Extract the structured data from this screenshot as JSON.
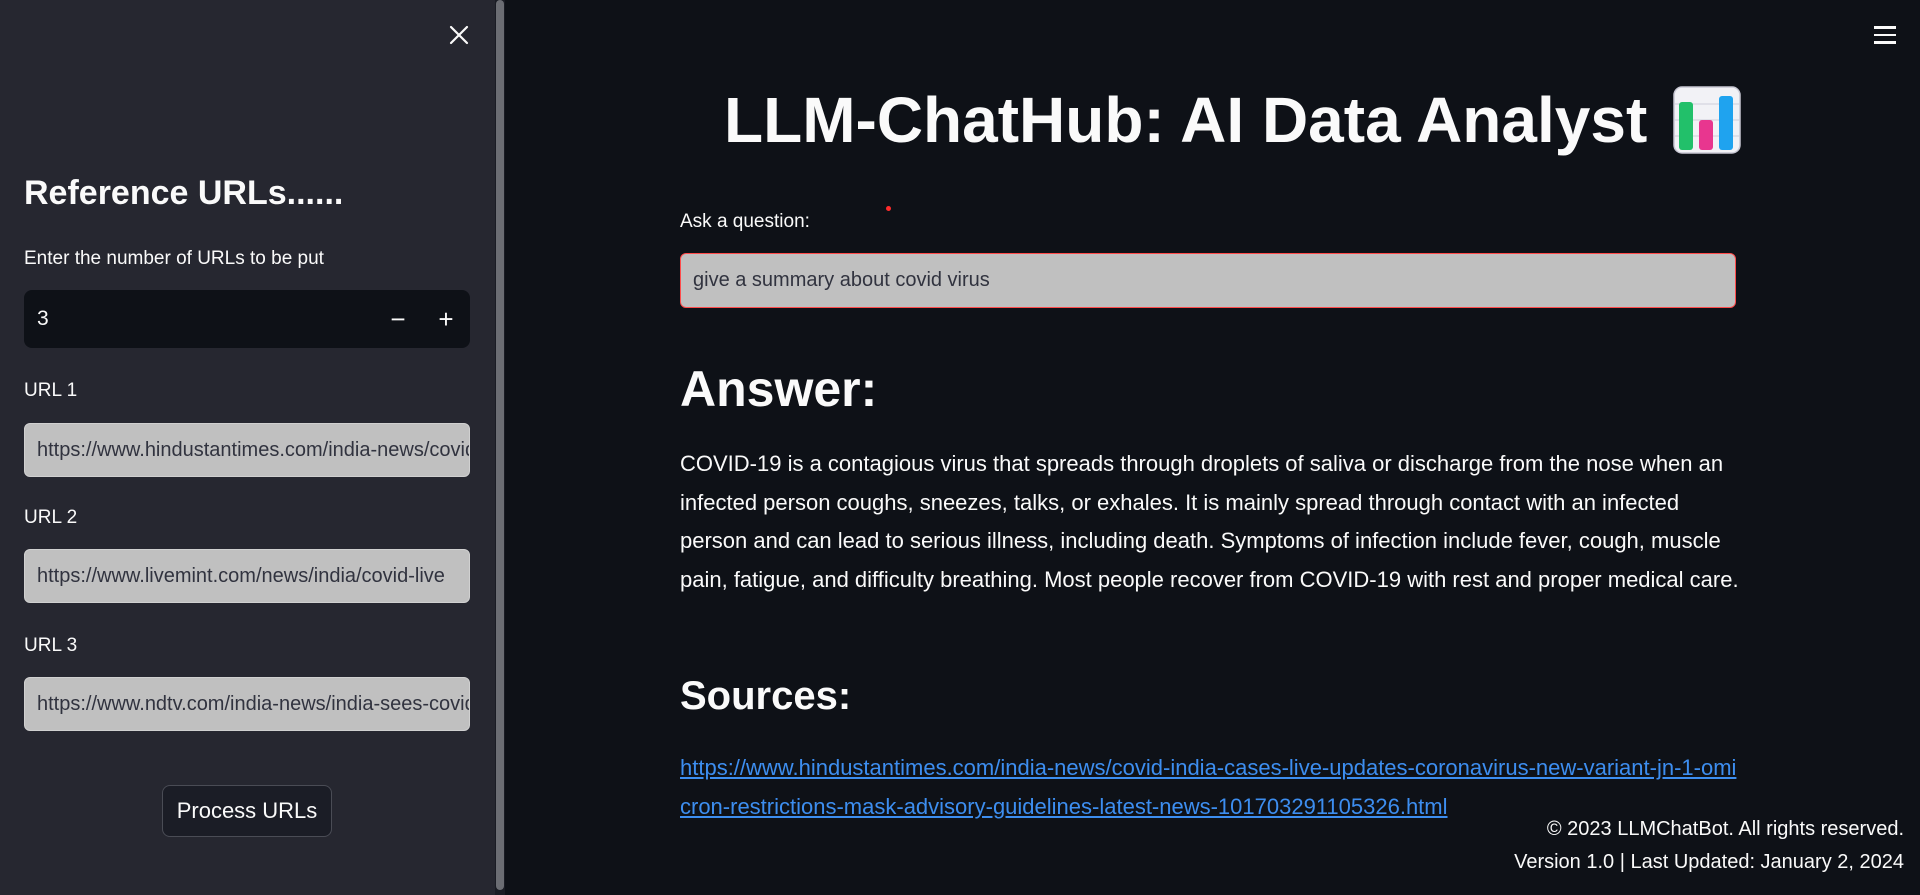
{
  "sidebar": {
    "heading": "Reference URLs......",
    "count_label": "Enter the number of URLs to be put",
    "count_value": "3",
    "decrement": "−",
    "increment": "+",
    "urls": [
      {
        "label": "URL 1",
        "value": "https://www.hindustantimes.com/india-news/covid-india-cases"
      },
      {
        "label": "URL 2",
        "value": "https://www.livemint.com/news/india/covid-live"
      },
      {
        "label": "URL 3",
        "value": "https://www.ndtv.com/india-news/india-sees-covid"
      }
    ],
    "process_button": "Process URLs"
  },
  "main": {
    "title": "LLM-ChatHub: AI Data Analyst",
    "title_icon": "bar-chart-emoji",
    "question_label": "Ask a question:",
    "question_value": "give a summary about covid virus",
    "answer_heading": "Answer:",
    "answer_text": "COVID-19 is a contagious virus that spreads through droplets of saliva or discharge from the nose when an infected person coughs, sneezes, talks, or exhales. It is mainly spread through contact with an infected person and can lead to serious illness, including death. Symptoms of infection include fever, cough, muscle pain, fatigue, and difficulty breathing. Most people recover from COVID-19 with rest and proper medical care.",
    "sources_heading": "Sources:",
    "source_link": "https://www.hindustantimes.com/india-news/covid-india-cases-live-updates-coronavirus-new-variant-jn-1-omicron-restrictions-mask-advisory-guidelines-latest-news-101703291105326.html"
  },
  "footer": {
    "copyright": "© 2023 LLMChatBot. All rights reserved.",
    "version": "Version 1.0 | Last Updated: January 2, 2024"
  },
  "colors": {
    "background": "#0e1117",
    "sidebar": "#262730",
    "link": "#3d8ef0",
    "focus_border": "#ff4b4b"
  }
}
